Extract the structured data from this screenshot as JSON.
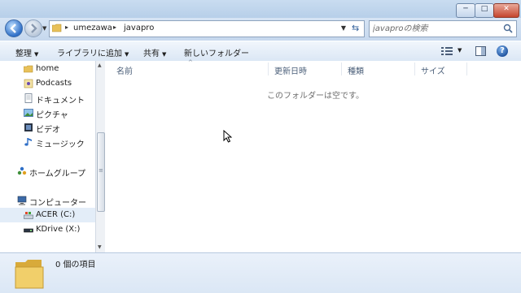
{
  "window": {
    "controls": {
      "minimize": "─",
      "maximize": "□",
      "close": "✕"
    }
  },
  "address": {
    "crumbs": [
      "umezawa",
      "javapro"
    ],
    "separator": "▸"
  },
  "search": {
    "placeholder": "javaproの検索"
  },
  "toolbar": {
    "organize": "整理",
    "add_to_library": "ライブラリに追加",
    "share": "共有",
    "new_folder": "新しいフォルダー"
  },
  "nav_pane": {
    "items": [
      {
        "label": "home",
        "icon": "folder-icon"
      },
      {
        "label": "Podcasts",
        "icon": "podcast-icon"
      },
      {
        "label": "ドキュメント",
        "icon": "documents-icon"
      },
      {
        "label": "ピクチャ",
        "icon": "pictures-icon"
      },
      {
        "label": "ビデオ",
        "icon": "videos-icon"
      },
      {
        "label": "ミュージック",
        "icon": "music-icon"
      },
      {
        "label": "ホームグループ",
        "icon": "homegroup-icon"
      },
      {
        "label": "コンピューター",
        "icon": "computer-icon"
      },
      {
        "label": "ACER (C:)",
        "icon": "drive-icon",
        "selected": true
      },
      {
        "label": "KDrive (X:)",
        "icon": "usb-drive-icon"
      }
    ]
  },
  "columns": [
    "名前",
    "更新日時",
    "種類",
    "サイズ"
  ],
  "content": {
    "empty_message": "このフォルダーは空です。"
  },
  "details": {
    "item_count": "0 個の項目"
  },
  "colors": {
    "chrome": "#dfe9f5",
    "accent": "#2f6fc7",
    "folder": "#e8c15a"
  }
}
